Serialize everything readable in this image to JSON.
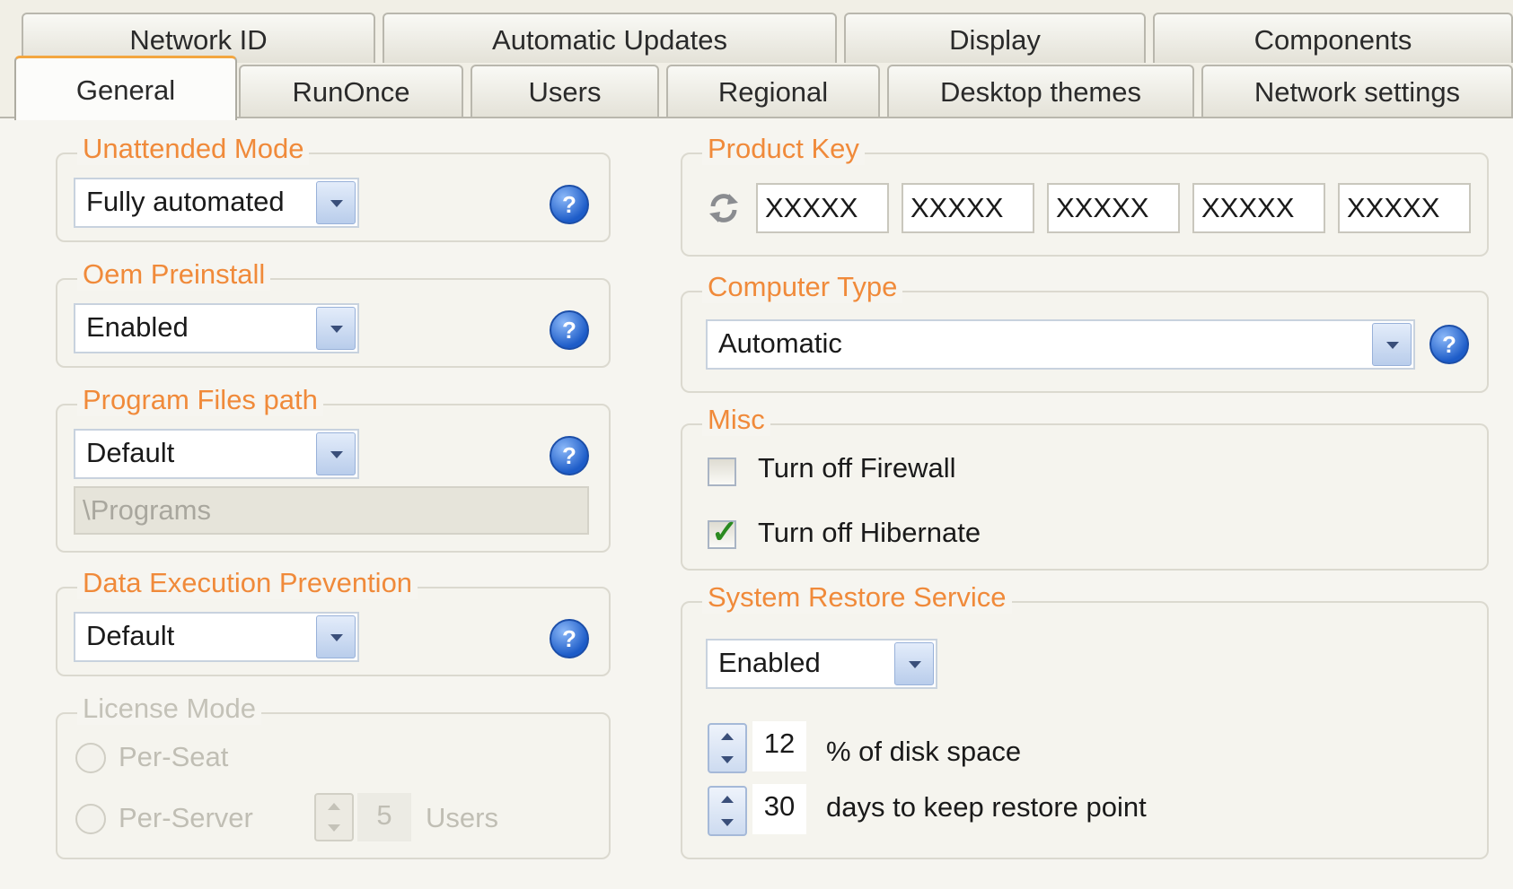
{
  "tabs": {
    "row1": [
      "Network ID",
      "Automatic Updates",
      "Display",
      "Components"
    ],
    "row2": [
      "General",
      "RunOnce",
      "Users",
      "Regional",
      "Desktop themes",
      "Network settings"
    ],
    "active": "General"
  },
  "unattended_mode": {
    "legend": "Unattended Mode",
    "value": "Fully automated"
  },
  "oem_preinstall": {
    "legend": "Oem Preinstall",
    "value": "Enabled"
  },
  "program_files": {
    "legend": "Program Files path",
    "value": "Default",
    "path": "\\Programs"
  },
  "dep": {
    "legend": "Data Execution Prevention",
    "value": "Default"
  },
  "license_mode": {
    "legend": "License Mode",
    "per_seat": "Per-Seat",
    "per_server": "Per-Server",
    "users_value": "5",
    "users_label": "Users"
  },
  "product_key": {
    "legend": "Product Key",
    "parts": [
      "XXXXX",
      "XXXXX",
      "XXXXX",
      "XXXXX",
      "XXXXX"
    ]
  },
  "computer_type": {
    "legend": "Computer Type",
    "value": "Automatic"
  },
  "misc": {
    "legend": "Misc",
    "firewall_label": "Turn off Firewall",
    "firewall_checked": false,
    "hibernate_label": "Turn off Hibernate",
    "hibernate_checked": true
  },
  "system_restore": {
    "legend": "System Restore Service",
    "value": "Enabled",
    "disk_value": "12",
    "disk_label": "% of disk space",
    "days_value": "30",
    "days_label": "days to keep restore point"
  },
  "help_glyph": "?",
  "icons": {
    "help": "help-icon",
    "dropdown": "chevron-down-icon",
    "product_key": "refresh-key-icon"
  }
}
